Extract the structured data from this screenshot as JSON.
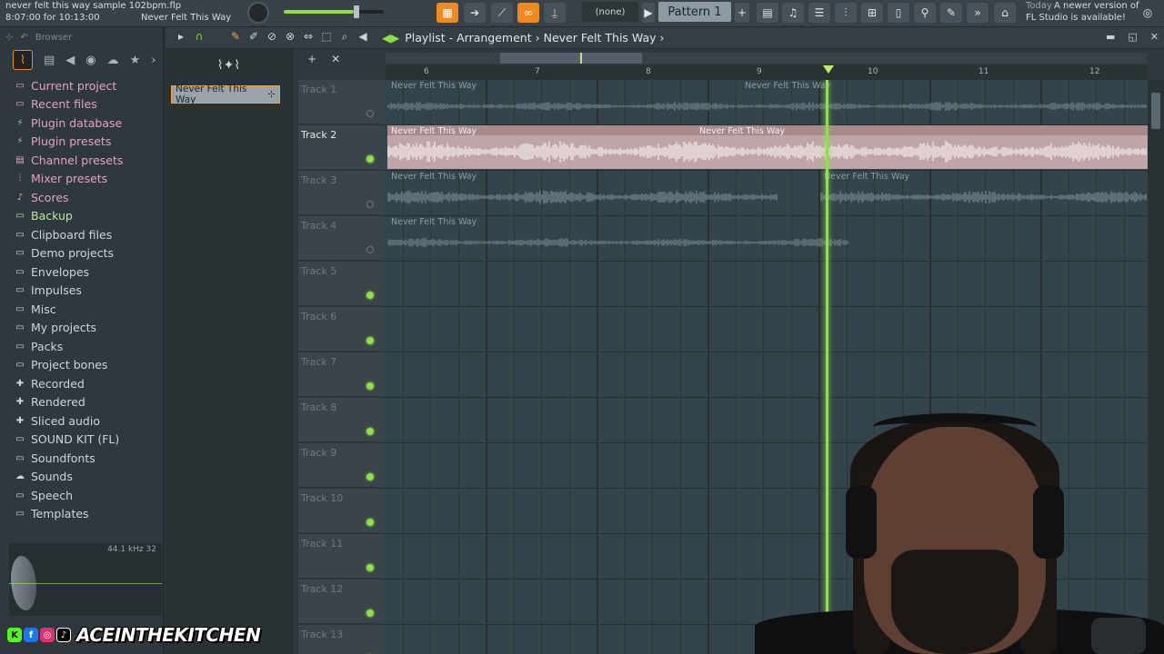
{
  "topbar": {
    "project_file": "never felt this way sample 102bpm.flp",
    "time_info": "8:07:00 for 10:13:00",
    "hint_text": "Never Felt This Way",
    "channel_select": "(none)",
    "pattern": "Pattern 1",
    "news_date": "Today",
    "news_line1": "A newer version of",
    "news_line2": "FL Studio is available!"
  },
  "browser": {
    "title": "Browser",
    "items": [
      {
        "label": "Current project",
        "icon": "folder-icon",
        "tone": "pink"
      },
      {
        "label": "Recent files",
        "icon": "folder-icon",
        "tone": "pink"
      },
      {
        "label": "Plugin database",
        "icon": "plug-icon",
        "tone": "pink"
      },
      {
        "label": "Plugin presets",
        "icon": "plug-icon",
        "tone": "pink"
      },
      {
        "label": "Channel presets",
        "icon": "channel-icon",
        "tone": "pink"
      },
      {
        "label": "Mixer presets",
        "icon": "mixer-icon",
        "tone": "pink"
      },
      {
        "label": "Scores",
        "icon": "note-icon",
        "tone": "pink"
      },
      {
        "label": "Backup",
        "icon": "folder-icon",
        "tone": "green"
      },
      {
        "label": "Clipboard files",
        "icon": "folder-icon",
        "tone": "plain"
      },
      {
        "label": "Demo projects",
        "icon": "folder-icon",
        "tone": "plain"
      },
      {
        "label": "Envelopes",
        "icon": "folder-icon",
        "tone": "plain"
      },
      {
        "label": "Impulses",
        "icon": "folder-icon",
        "tone": "plain"
      },
      {
        "label": "Misc",
        "icon": "folder-icon",
        "tone": "plain"
      },
      {
        "label": "My projects",
        "icon": "folder-icon",
        "tone": "plain"
      },
      {
        "label": "Packs",
        "icon": "folder-icon",
        "tone": "plain"
      },
      {
        "label": "Project bones",
        "icon": "folder-icon",
        "tone": "plain"
      },
      {
        "label": "Recorded",
        "icon": "plus-icon",
        "tone": "plain"
      },
      {
        "label": "Rendered",
        "icon": "plus-icon",
        "tone": "plain"
      },
      {
        "label": "Sliced audio",
        "icon": "plus-icon",
        "tone": "plain"
      },
      {
        "label": "SOUND KIT (FL)",
        "icon": "folder-icon",
        "tone": "plain"
      },
      {
        "label": "Soundfonts",
        "icon": "folder-icon",
        "tone": "plain"
      },
      {
        "label": "Sounds",
        "icon": "cloud-icon",
        "tone": "plain"
      },
      {
        "label": "Speech",
        "icon": "folder-icon",
        "tone": "plain"
      },
      {
        "label": "Templates",
        "icon": "folder-icon",
        "tone": "plain"
      }
    ],
    "preview_rate": "44.1 kHz 32"
  },
  "playlist": {
    "breadcrumb_1": "Playlist - Arrangement",
    "breadcrumb_sep": "›",
    "breadcrumb_2": "Never Felt This Way",
    "breadcrumb_end": "›",
    "picker_clip": "Never Felt This Way",
    "ruler": [
      "6",
      "7",
      "8",
      "9",
      "10",
      "11",
      "12"
    ],
    "tracks": [
      {
        "name": "Track 1",
        "active": false
      },
      {
        "name": "Track 2",
        "active": true
      },
      {
        "name": "Track 3",
        "active": false
      },
      {
        "name": "Track 4",
        "active": false
      },
      {
        "name": "Track 5",
        "active": false
      },
      {
        "name": "Track 6",
        "active": false
      },
      {
        "name": "Track 7",
        "active": false
      },
      {
        "name": "Track 8",
        "active": false
      },
      {
        "name": "Track 9",
        "active": false
      },
      {
        "name": "Track 10",
        "active": false
      },
      {
        "name": "Track 11",
        "active": false
      },
      {
        "name": "Track 12",
        "active": false
      },
      {
        "name": "Track 13",
        "active": false
      }
    ],
    "clip_name": "Never Felt This Way"
  },
  "watermark": {
    "handle": "ACEINTHEKITCHEN"
  },
  "colors": {
    "accent_green": "#8ee04a",
    "accent_orange": "#f08a1e",
    "clip_main": "#bfa5a7",
    "grid_bg": "#34444b"
  }
}
